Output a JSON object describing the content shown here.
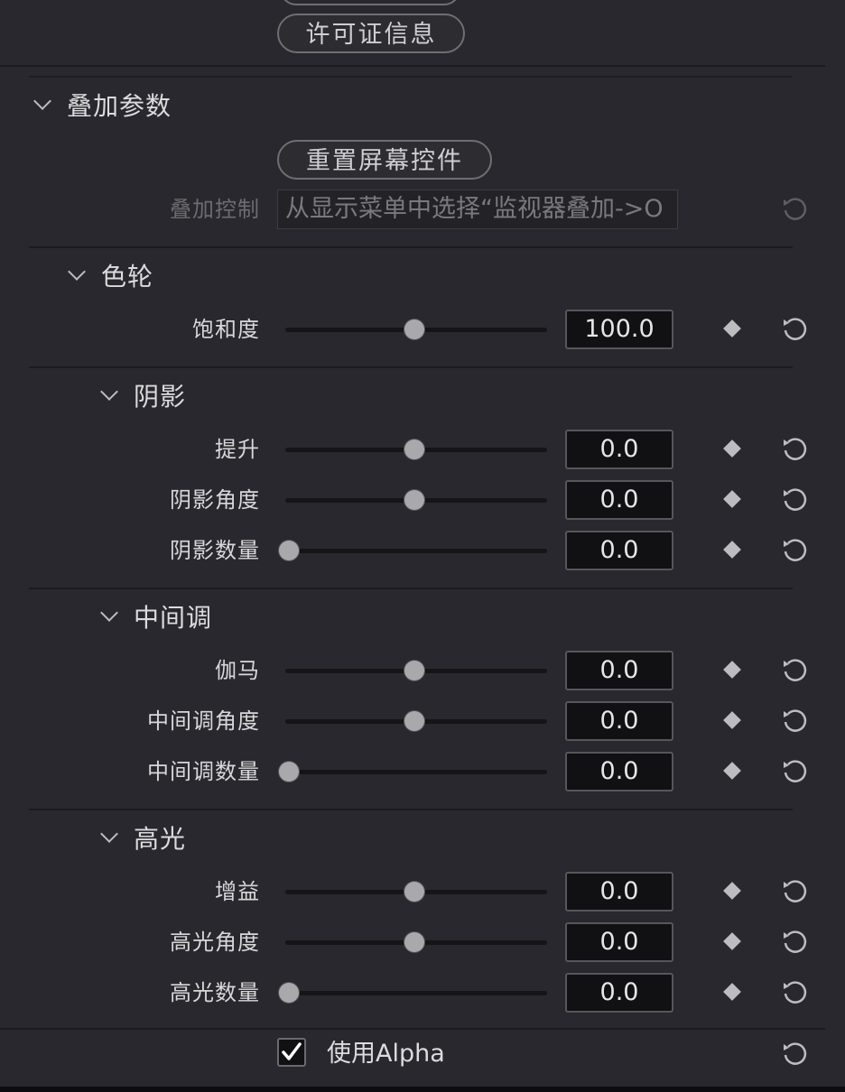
{
  "license_button": "许可证信息",
  "overlay": {
    "title": "叠加参数",
    "reset_button": "重置屏幕控件",
    "control_label": "叠加控制",
    "control_value": "从显示菜单中选择“监视器叠加->O"
  },
  "color_wheel": {
    "title": "色轮",
    "saturation": {
      "label": "饱和度",
      "value": "100.0",
      "slider": 0.5
    }
  },
  "shadows": {
    "title": "阴影",
    "params": [
      {
        "label": "提升",
        "value": "0.0",
        "slider": 0.5
      },
      {
        "label": "阴影角度",
        "value": "0.0",
        "slider": 0.5
      },
      {
        "label": "阴影数量",
        "value": "0.0",
        "slider": 0.0
      }
    ]
  },
  "midtones": {
    "title": "中间调",
    "params": [
      {
        "label": "伽马",
        "value": "0.0",
        "slider": 0.5
      },
      {
        "label": "中间调角度",
        "value": "0.0",
        "slider": 0.5
      },
      {
        "label": "中间调数量",
        "value": "0.0",
        "slider": 0.0
      }
    ]
  },
  "highlights": {
    "title": "高光",
    "params": [
      {
        "label": "增益",
        "value": "0.0",
        "slider": 0.5
      },
      {
        "label": "高光角度",
        "value": "0.0",
        "slider": 0.5
      },
      {
        "label": "高光数量",
        "value": "0.0",
        "slider": 0.0
      }
    ]
  },
  "use_alpha": {
    "label": "使用Alpha",
    "checked": true
  },
  "icons": {
    "chevron": "chevron-down-icon",
    "keyframe": "keyframe-diamond-icon",
    "reset": "reset-icon",
    "check": "checkmark-icon"
  },
  "colors": {
    "background": "#28282e",
    "field": "#111113",
    "handle": "#a9a9ad"
  }
}
